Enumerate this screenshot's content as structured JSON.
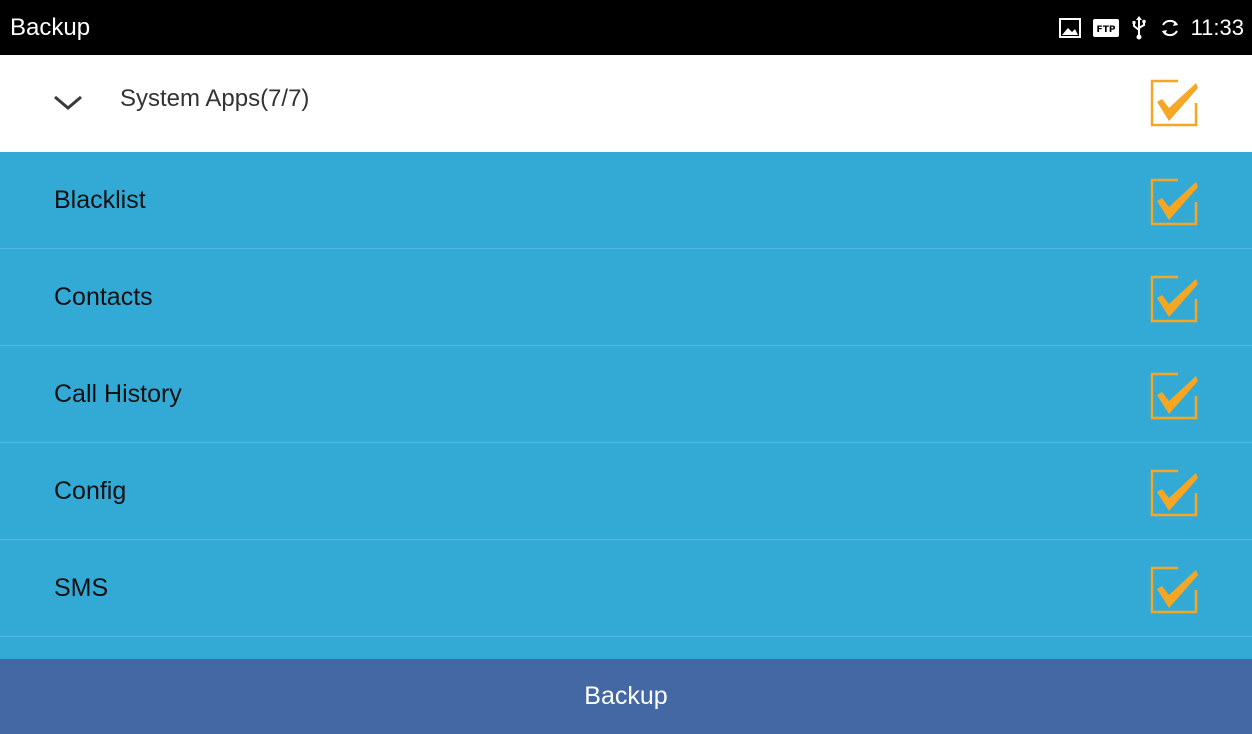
{
  "status_bar": {
    "title": "Backup",
    "time": "11:33",
    "icons": [
      "picture-icon",
      "ftp-icon",
      "usb-icon",
      "sync-icon"
    ],
    "ftp_text": "FTP"
  },
  "group": {
    "title": "System Apps(7/7)",
    "checked": true
  },
  "items": [
    {
      "label": "Blacklist",
      "checked": true
    },
    {
      "label": "Contacts",
      "checked": true
    },
    {
      "label": "Call History",
      "checked": true
    },
    {
      "label": "Config",
      "checked": true
    },
    {
      "label": "SMS",
      "checked": true
    }
  ],
  "footer": {
    "backup_label": "Backup"
  },
  "colors": {
    "status_bar": "#000000",
    "list_background": "#33aad6",
    "checkbox_accent": "#f5a623",
    "footer_button": "#4368a3"
  }
}
